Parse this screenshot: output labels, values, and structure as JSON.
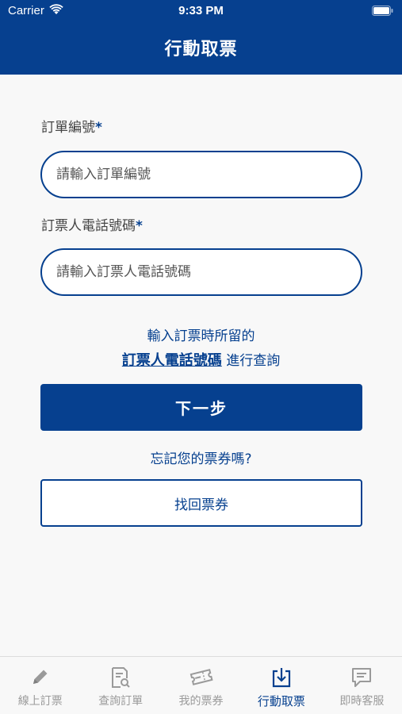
{
  "status_bar": {
    "carrier": "Carrier",
    "time": "9:33 PM"
  },
  "header": {
    "title": "行動取票"
  },
  "form": {
    "order_label": "訂單編號",
    "order_placeholder": "請輸入訂單編號",
    "phone_label": "訂票人電話號碼",
    "phone_placeholder": "請輸入訂票人電話號碼",
    "required_mark": "*"
  },
  "hint": {
    "line1": "輸入訂票時所留的",
    "link": "訂票人電話號碼",
    "line2_rest": " 進行查詢"
  },
  "next_button": "下一步",
  "forgot_text": "忘記您的票券嗎?",
  "recover_button": "找回票券",
  "tabs": [
    {
      "label": "線上訂票",
      "icon": "pencil-icon"
    },
    {
      "label": "查詢訂單",
      "icon": "document-search-icon"
    },
    {
      "label": "我的票券",
      "icon": "ticket-icon"
    },
    {
      "label": "行動取票",
      "icon": "download-tray-icon",
      "active": true
    },
    {
      "label": "即時客服",
      "icon": "chat-bubble-icon"
    }
  ],
  "colors": {
    "primary": "#06408f",
    "inactive": "#9a9a9a"
  }
}
